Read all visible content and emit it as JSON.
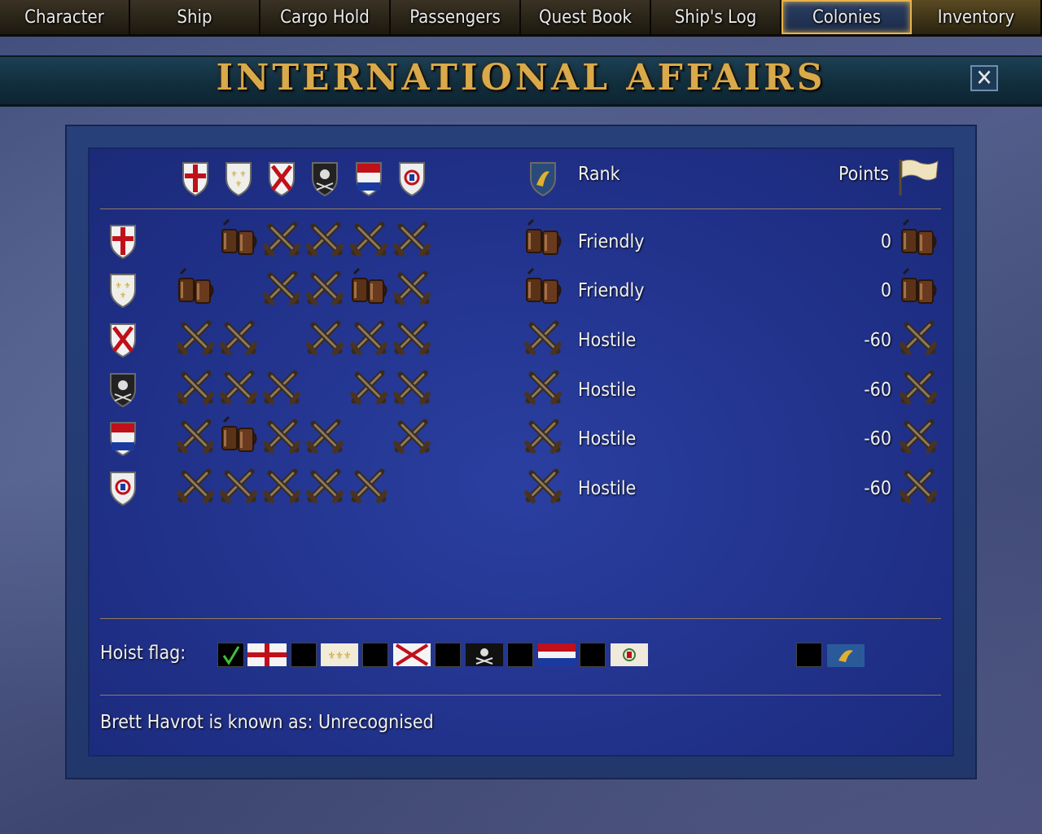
{
  "tabs": [
    "Character",
    "Ship",
    "Cargo Hold",
    "Passengers",
    "Quest Book",
    "Ship's Log",
    "Colonies",
    "Inventory"
  ],
  "title": "INTERNATIONAL AFFAIRS",
  "header": {
    "rank_label": "Rank",
    "points_label": "Points"
  },
  "rows": [
    {
      "nation": "england",
      "relations": [
        "empty",
        "tankard",
        "pistols",
        "pistols",
        "pistols",
        "pistols"
      ],
      "status": "Friendly",
      "status_icon": "tankard",
      "points": "0",
      "points_icon": "tankard"
    },
    {
      "nation": "france",
      "relations": [
        "tankard",
        "empty",
        "pistols",
        "pistols",
        "tankard",
        "pistols"
      ],
      "status": "Friendly",
      "status_icon": "tankard",
      "points": "0",
      "points_icon": "tankard"
    },
    {
      "nation": "spain",
      "relations": [
        "pistols",
        "pistols",
        "empty",
        "pistols",
        "pistols",
        "pistols"
      ],
      "status": "Hostile",
      "status_icon": "pistols",
      "points": "-60",
      "points_icon": "pistols"
    },
    {
      "nation": "pirates",
      "relations": [
        "pistols",
        "pistols",
        "pistols",
        "empty",
        "pistols",
        "pistols"
      ],
      "status": "Hostile",
      "status_icon": "pistols",
      "points": "-60",
      "points_icon": "pistols"
    },
    {
      "nation": "holland",
      "relations": [
        "pistols",
        "tankard",
        "pistols",
        "pistols",
        "empty",
        "pistols"
      ],
      "status": "Hostile",
      "status_icon": "pistols",
      "points": "-60",
      "points_icon": "pistols"
    },
    {
      "nation": "portugal",
      "relations": [
        "pistols",
        "pistols",
        "pistols",
        "pistols",
        "pistols",
        "empty"
      ],
      "status": "Hostile",
      "status_icon": "pistols",
      "points": "-60",
      "points_icon": "pistols"
    }
  ],
  "hoist": {
    "label": "Hoist flag:",
    "selected": "none",
    "options": [
      "none",
      "england",
      "france",
      "spain",
      "pirates",
      "holland",
      "portugal",
      "personal"
    ]
  },
  "known_as": "Brett Havrot is known as: Unrecognised",
  "colors": {
    "gold": "#d9a94a",
    "panel": "#22348c",
    "text": "#f0f0f0"
  }
}
